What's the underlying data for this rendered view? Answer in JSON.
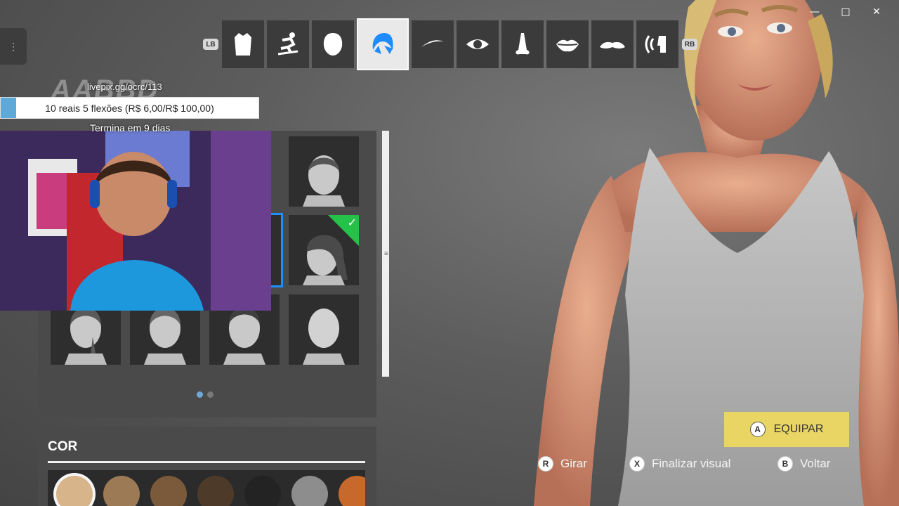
{
  "window": {
    "minimize": "—",
    "maximize": "□",
    "close": "✕"
  },
  "menu": {
    "icon": "dots-vertical-icon"
  },
  "categories": {
    "left_bumper": "LB",
    "right_bumper": "RB",
    "tabs": [
      {
        "icon": "clothing-icon"
      },
      {
        "icon": "skate-pose-icon"
      },
      {
        "icon": "head-shape-icon"
      },
      {
        "icon": "hair-icon",
        "active": true
      },
      {
        "icon": "eyebrow-icon"
      },
      {
        "icon": "eye-icon"
      },
      {
        "icon": "nose-icon"
      },
      {
        "icon": "lips-icon"
      },
      {
        "icon": "mustache-icon"
      },
      {
        "icon": "voice-icon"
      }
    ]
  },
  "panel": {
    "selected_style_index": 4,
    "equipped_style_index": 5,
    "page": 1,
    "pages": 2
  },
  "color": {
    "title": "COR",
    "swatches": [
      "#d7b48a",
      "#9b7a55",
      "#7a5a3a",
      "#4d3a28",
      "#232323",
      "#8d8d8d",
      "#c7692b"
    ],
    "selected_index": 0
  },
  "stream_goal": {
    "url": "livepix.gg/ocrc/113",
    "watermark": "AABBD",
    "text": "10 reais 5 flexões (R$ 6,00/R$ 100,00)",
    "progress": 0.06,
    "ends": "Termina em 9 dias"
  },
  "actions": {
    "equip": {
      "button": "A",
      "label": "EQUIPAR"
    },
    "rotate": {
      "button": "R",
      "label": "Girar"
    },
    "finalize": {
      "button": "X",
      "label": "Finalizar visual"
    },
    "back": {
      "button": "B",
      "label": "Voltar"
    }
  }
}
